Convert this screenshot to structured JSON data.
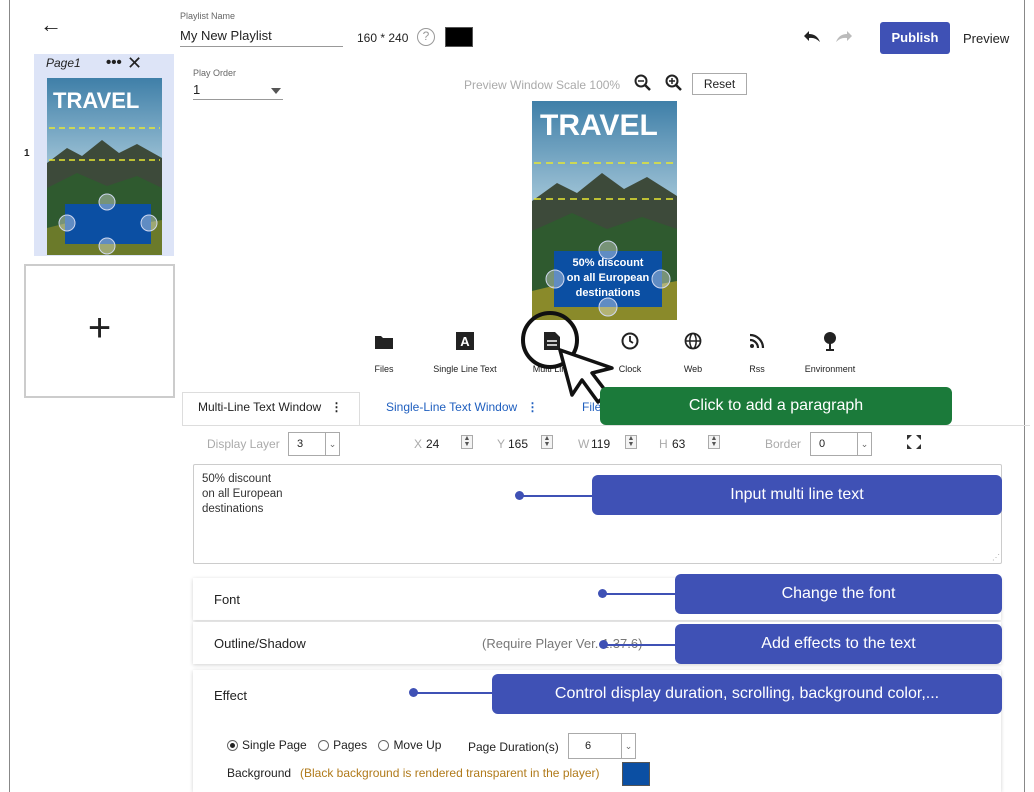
{
  "header": {
    "back_icon": "arrow-left-icon",
    "playlist_name_label": "Playlist Name",
    "playlist_name_value": "My New Playlist",
    "resolution": "160 * 240",
    "background_color": "#000000",
    "publish_label": "Publish",
    "preview_label": "Preview",
    "accent_color": "#3f51b5"
  },
  "pages": [
    {
      "name": "Page1",
      "number": "1",
      "menu_label": "•••",
      "close_label": "✕",
      "thumb_title": "TRAVEL"
    }
  ],
  "add_page_label": "+",
  "play_order": {
    "label": "Play Order",
    "value": "1"
  },
  "preview": {
    "scale_label": "Preview Window Scale",
    "scale_value": "100%",
    "reset_label": "Reset",
    "title": "TRAVEL",
    "overlay_text": [
      "50% discount",
      "on all European",
      "destinations"
    ]
  },
  "toolbar": [
    {
      "label": "Files",
      "icon": "folder-icon"
    },
    {
      "label": "Single Line Text",
      "icon": "text-a-icon"
    },
    {
      "label": "Multi Line",
      "icon": "multi-line-text-icon"
    },
    {
      "label": "Clock",
      "icon": "clock-icon"
    },
    {
      "label": "Web",
      "icon": "globe-icon"
    },
    {
      "label": "Rss",
      "icon": "rss-icon"
    },
    {
      "label": "Environment",
      "icon": "pin-icon"
    }
  ],
  "tabs": [
    {
      "label": "Multi-Line Text Window",
      "menu": "⋮"
    },
    {
      "label": "Single-Line Text Window",
      "menu": "⋮"
    },
    {
      "label": "File"
    }
  ],
  "callouts": {
    "add_paragraph": "Click to add a paragraph",
    "input_text": "Input multi line text",
    "font": "Change the font",
    "effects": "Add effects to the text",
    "effect": "Control display duration, scrolling, background color,..."
  },
  "properties": {
    "display_layer_label": "Display Layer",
    "display_layer_value": "3",
    "x_label": "X",
    "x_value": "24",
    "y_label": "Y",
    "y_value": "165",
    "w_label": "W",
    "w_value": "119",
    "h_label": "H",
    "h_value": "63",
    "border_label": "Border",
    "border_value": "0"
  },
  "text_content": "50% discount\non all European\ndestinations",
  "panels": {
    "font_label": "Font",
    "outline_label": "Outline/Shadow",
    "outline_note": "(Require Player Ver. 1.37.6)",
    "effect_label": "Effect"
  },
  "effect": {
    "options": [
      "Single Page",
      "Pages",
      "Move Up"
    ],
    "selected": "Single Page",
    "duration_label": "Page Duration(s)",
    "duration_value": "6",
    "background_label": "Background",
    "background_note": "(Black background is rendered transparent in the player)",
    "background_color": "#0b4fa3"
  }
}
